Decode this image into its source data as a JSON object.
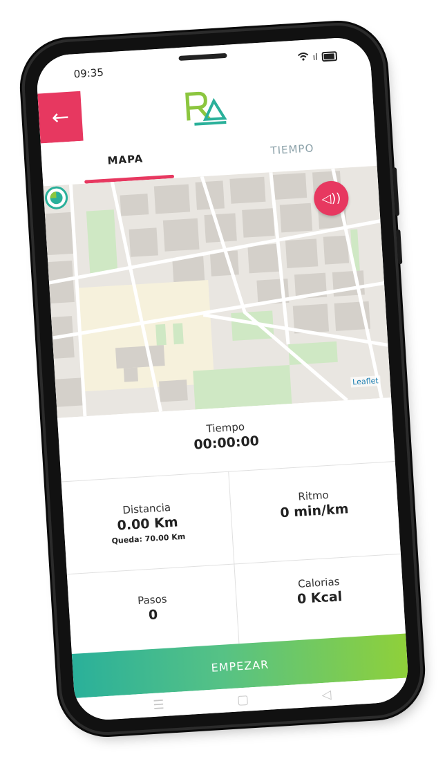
{
  "status_bar": {
    "time": "09:35",
    "signal": "ıl"
  },
  "app_bar": {
    "back_icon": "arrow-left-icon",
    "logo_text": "RA",
    "accent_color": "#e73860"
  },
  "tabs": [
    {
      "label": "MAPA",
      "active": true
    },
    {
      "label": "TIEMPO",
      "active": false
    }
  ],
  "map": {
    "attribution": "Leaflet",
    "sound_icon": "speaker-icon"
  },
  "stats": {
    "tiempo": {
      "label": "Tiempo",
      "value": "00:00:00"
    },
    "distancia": {
      "label": "Distancia",
      "value": "0.00 Km",
      "remaining": "Queda: 70.00 Km"
    },
    "ritmo": {
      "label": "Ritmo",
      "value": "0 min/km"
    },
    "pasos": {
      "label": "Pasos",
      "value": "0"
    },
    "calorias": {
      "label": "Calorias",
      "value": "0 Kcal"
    }
  },
  "cta": {
    "label": "EMPEZAR",
    "gradient": [
      "#2ab09a",
      "#8fd03a"
    ]
  },
  "nav": {
    "menu_icon": "☰",
    "home_icon": "▢",
    "back_icon": "◁"
  }
}
